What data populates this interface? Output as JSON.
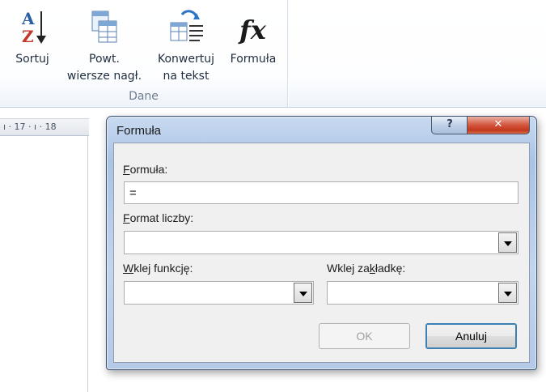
{
  "ribbon": {
    "group_label": "Dane",
    "buttons": [
      {
        "icon": "sort-az-icon",
        "label1": "Sortuj",
        "label2": ""
      },
      {
        "icon": "repeat-header-rows-icon",
        "label1": "Powt.",
        "label2": "wiersze nagł."
      },
      {
        "icon": "convert-to-text-icon",
        "label1": "Konwertuj",
        "label2": "na tekst"
      },
      {
        "icon": "formula-fx-icon",
        "label1": "Formuła",
        "label2": ""
      }
    ]
  },
  "ruler": {
    "text": "ı · 17 · ı · 18"
  },
  "dialog": {
    "title": "Formuła",
    "help_glyph": "?",
    "close_glyph": "✕",
    "formula_label_first": "F",
    "formula_label_rest": "ormuła:",
    "formula_value": "=",
    "format_label_first": "F",
    "format_label_rest": "ormat liczby:",
    "format_value": "",
    "paste_function_label_first": "W",
    "paste_function_label_rest": "klej funkcję:",
    "paste_function_value": "",
    "paste_bookmark_label_pre": "Wklej za",
    "paste_bookmark_label_u": "k",
    "paste_bookmark_label_post": "ładkę:",
    "paste_bookmark_value": "",
    "ok_label": "OK",
    "cancel_label": "Anuluj"
  },
  "colors": {
    "accent": "#3c7fb1",
    "close": "#c1381c",
    "frame": "#a9c3e6"
  }
}
